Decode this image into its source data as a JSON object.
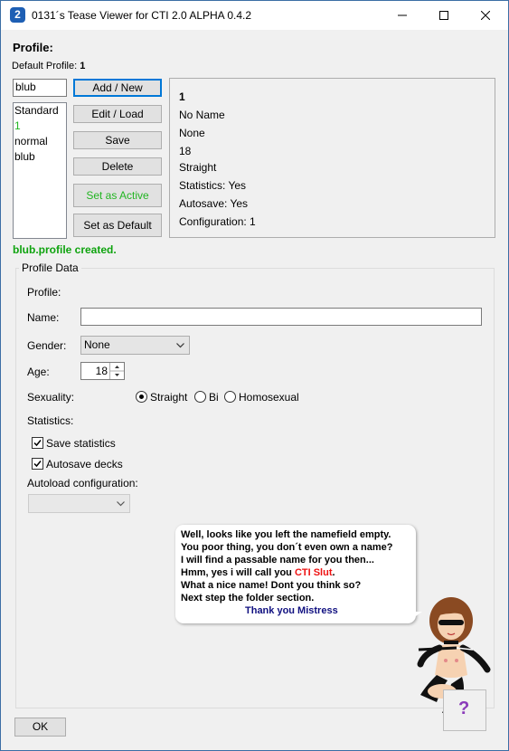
{
  "titlebar": {
    "app_icon_glyph": "2",
    "title": "0131´s Tease Viewer for CTI 2.0 ALPHA 0.4.2",
    "minimize_icon": "minimize-icon",
    "maximize_icon": "maximize-icon",
    "close_icon": "close-icon"
  },
  "header": {
    "profile_heading": "Profile:",
    "default_profile_label": "Default Profile:",
    "default_profile_value": "1"
  },
  "profile_name_input": {
    "value": "blub"
  },
  "profile_list": [
    "Standard",
    "1",
    "normal",
    "blub"
  ],
  "profile_list_active_index": 1,
  "buttons": {
    "add_new": "Add / New",
    "edit_load": "Edit / Load",
    "save": "Save",
    "delete": "Delete",
    "set_active": "Set as Active",
    "set_default": "Set as Default",
    "ok": "OK"
  },
  "info": {
    "profile_id": "1",
    "name": "No Name",
    "gender": "None",
    "age": "18",
    "sexuality": "Straight",
    "statistics": "Statistics: Yes",
    "autosave": "Autosave: Yes",
    "configuration": "Configuration: 1"
  },
  "status_message": "blub.profile created.",
  "profile_data": {
    "group_title": "Profile Data",
    "profile_label": "Profile:",
    "name_label": "Name:",
    "name_value": "",
    "gender_label": "Gender:",
    "gender_value": "None",
    "age_label": "Age:",
    "age_value": "18",
    "sexuality_label": "Sexuality:",
    "sexuality_options": [
      "Straight",
      "Bi",
      "Homosexual"
    ],
    "sexuality_selected": "Straight",
    "statistics_label": "Statistics:",
    "save_statistics_label": "Save statistics",
    "save_statistics_checked": true,
    "autosave_decks_label": "Autosave decks",
    "autosave_decks_checked": true,
    "autoload_label": "Autoload configuration:",
    "autoload_value": ""
  },
  "speech_bubble": {
    "line1": "Well, looks like you left the namefield empty.",
    "line2": "You poor thing, you don´t even own a name?",
    "line3": "I will find a passable name for you then...",
    "line4_prefix": "Hmm, yes i will call you ",
    "line4_name": "CTI Slut",
    "line4_suffix": ".",
    "line5": "What a nice name! Dont you think so?",
    "line6": "Next step the folder section.",
    "line7": "Thank you Mistress"
  },
  "help_button": {
    "glyph": "?"
  },
  "colors": {
    "active_green": "#22b522",
    "status_green": "#0ea30e",
    "name_red": "#ee1111",
    "thanks_navy": "#101080",
    "help_purple": "#8a3ab9"
  }
}
